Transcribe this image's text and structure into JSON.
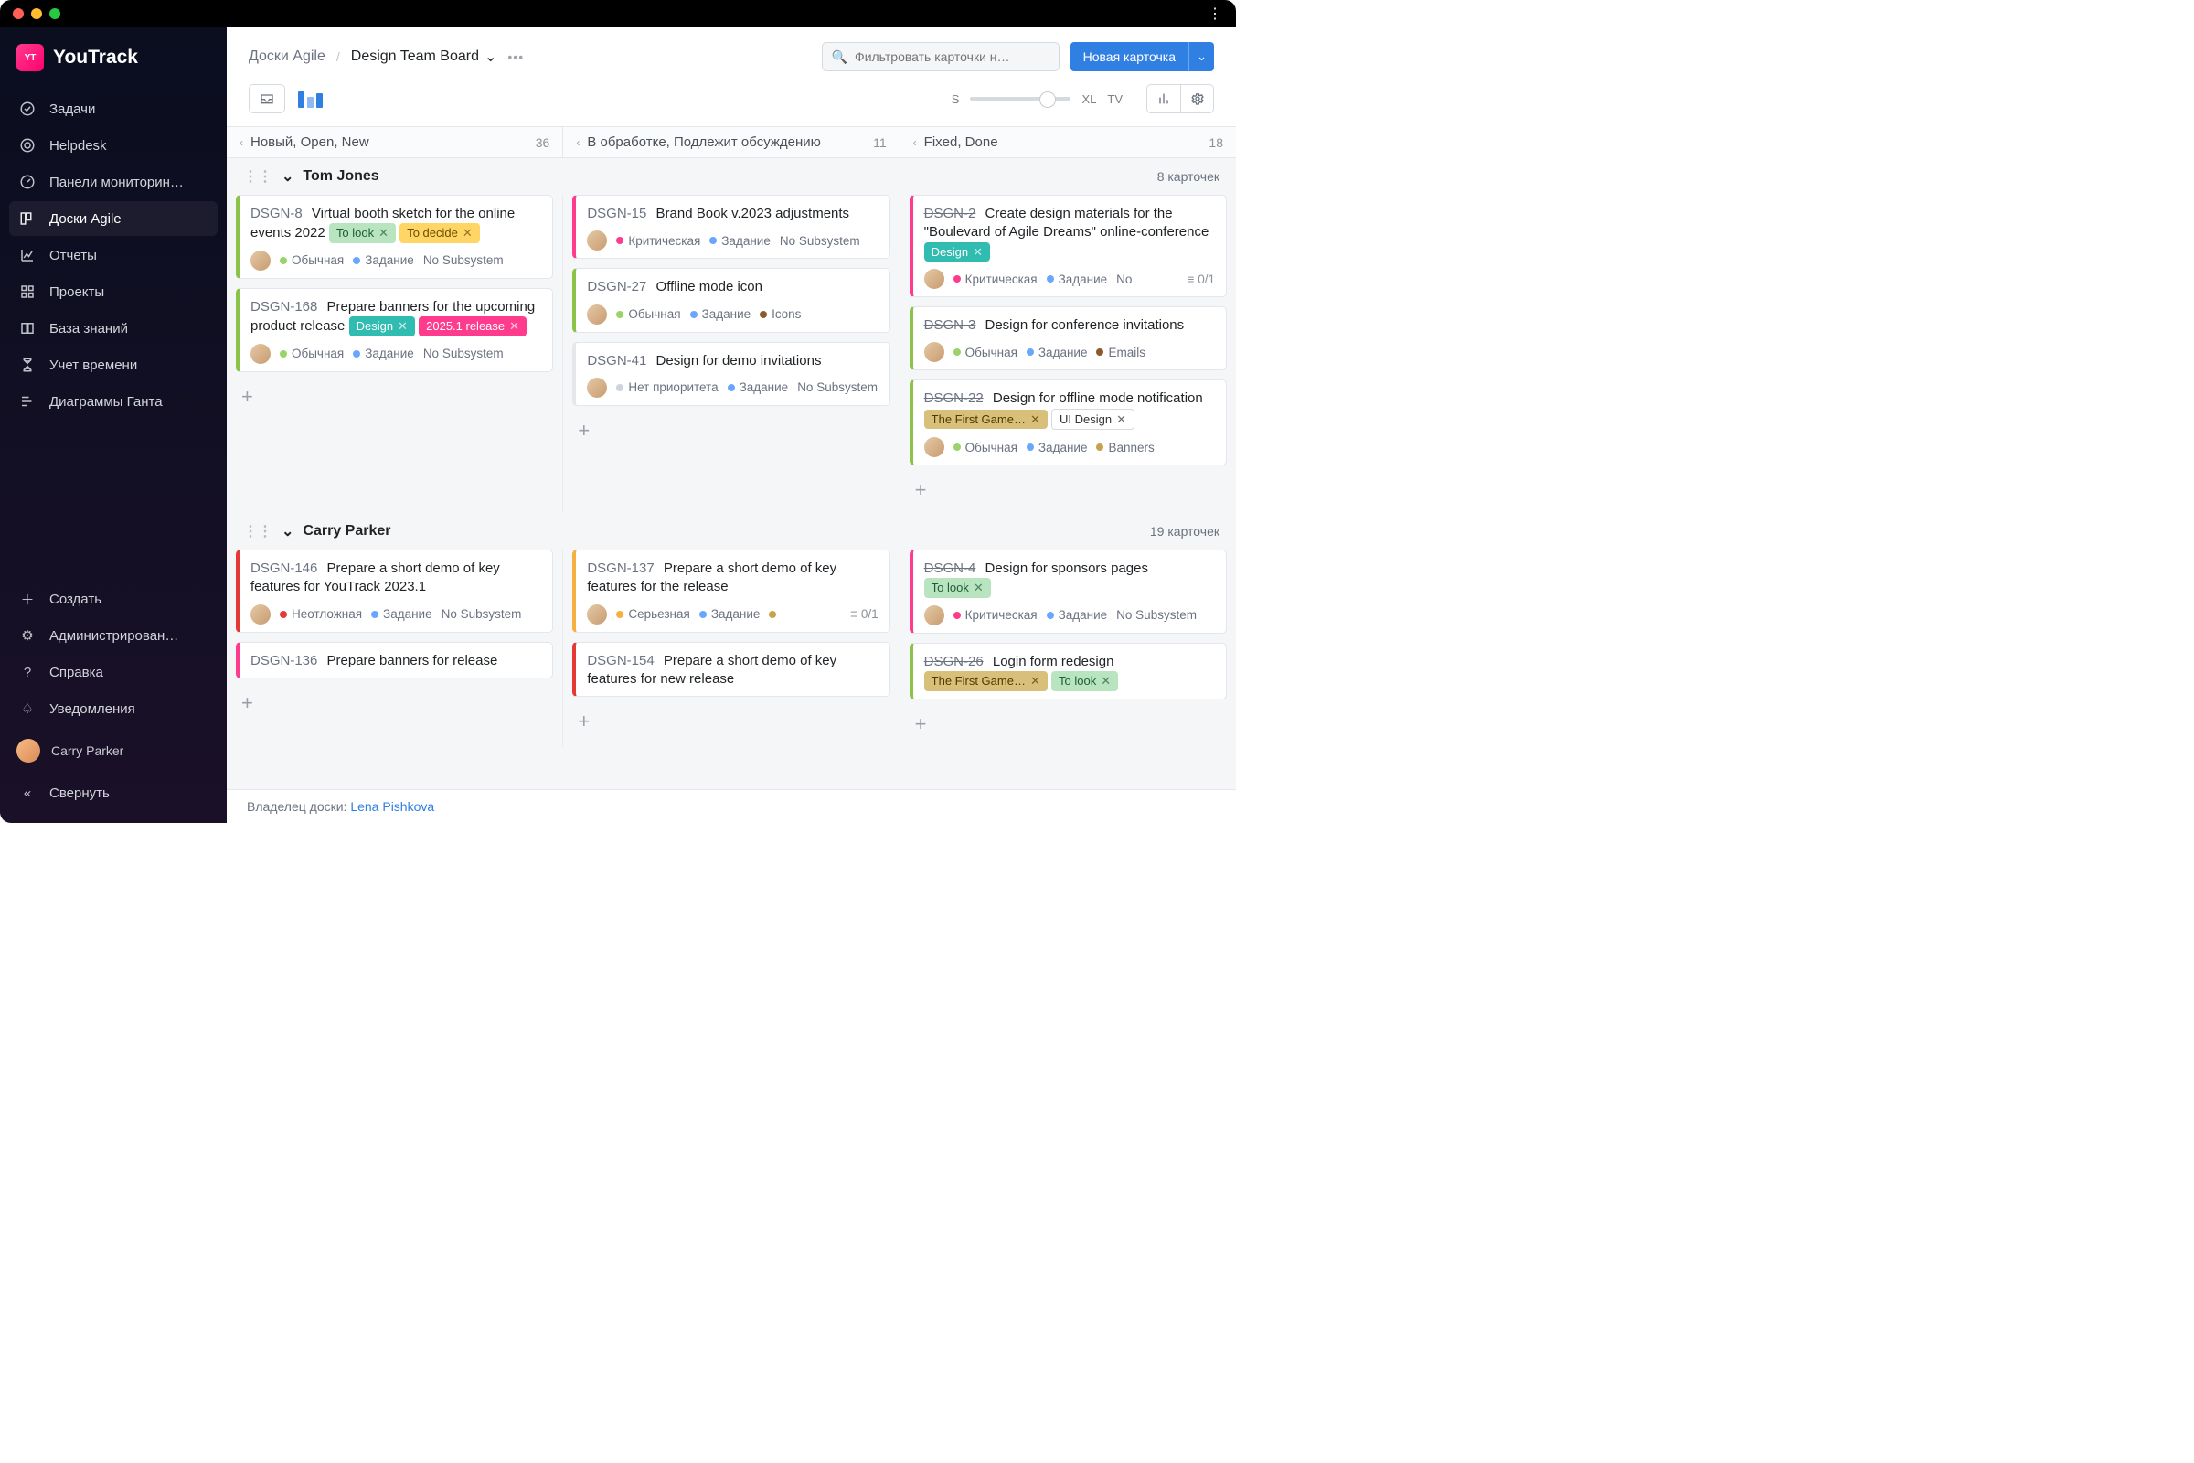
{
  "app": {
    "name": "YouTrack"
  },
  "sidebar": {
    "items": [
      {
        "label": "Задачи",
        "icon": "check-circle-icon"
      },
      {
        "label": "Helpdesk",
        "icon": "life-ring-icon"
      },
      {
        "label": "Панели мониторин…",
        "icon": "gauge-icon"
      },
      {
        "label": "Доски Agile",
        "icon": "board-icon",
        "active": true
      },
      {
        "label": "Отчеты",
        "icon": "chart-icon"
      },
      {
        "label": "Проекты",
        "icon": "grid-icon"
      },
      {
        "label": "База знаний",
        "icon": "book-icon"
      },
      {
        "label": "Учет времени",
        "icon": "hourglass-icon"
      },
      {
        "label": "Диаграммы Ганта",
        "icon": "gantt-icon"
      }
    ],
    "create": "Создать",
    "admin": "Администрирован…",
    "help": "Справка",
    "notifications": "Уведомления",
    "user": "Carry Parker",
    "collapse": "Свернуть"
  },
  "header": {
    "breadcrumb_root": "Доски Agile",
    "board_name": "Design Team Board",
    "search_placeholder": "Фильтровать карточки н…",
    "new_card": "Новая карточка",
    "size_s": "S",
    "size_xl": "XL",
    "size_tv": "TV"
  },
  "columns": [
    {
      "title": "Новый, Open, New",
      "count": "36"
    },
    {
      "title": "В обработке, Подлежит обсуждению",
      "count": "11"
    },
    {
      "title": "Fixed, Done",
      "count": "18"
    }
  ],
  "swimlanes": [
    {
      "name": "Tom Jones",
      "count": "8 карточек",
      "cols": [
        [
          {
            "id": "DSGN-8",
            "title": "Virtual booth sketch for the online events 2022",
            "stripe": "#8bc34a",
            "tags": [
              {
                "text": "To look",
                "bg": "#b8e4c0",
                "fg": "#1f5d2f",
                "x": true
              },
              {
                "text": "To decide",
                "bg": "#ffd666",
                "fg": "#6b4e00",
                "x": true
              }
            ],
            "meta": {
              "priority": {
                "text": "Обычная",
                "color": "#9ad36a"
              },
              "type": {
                "text": "Задание",
                "color": "#6aa6ff"
              },
              "subsystem": "No Subsystem"
            }
          },
          {
            "id": "DSGN-168",
            "title": "Prepare banners for the upcoming product release",
            "stripe": "#8bc34a",
            "tags": [
              {
                "text": "Design",
                "bg": "#30bcb0",
                "fg": "#ffffff",
                "x": true
              },
              {
                "text": "2025.1 release",
                "bg": "#ff3b8d",
                "fg": "#ffffff",
                "x": true
              }
            ],
            "meta": {
              "priority": {
                "text": "Обычная",
                "color": "#9ad36a"
              },
              "type": {
                "text": "Задание",
                "color": "#6aa6ff"
              },
              "subsystem": "No Subsystem"
            }
          }
        ],
        [
          {
            "id": "DSGN-15",
            "title": "Brand Book v.2023 adjustments",
            "stripe": "#ff3b8d",
            "meta": {
              "priority": {
                "text": "Критическая",
                "color": "#ff3b8d"
              },
              "type": {
                "text": "Задание",
                "color": "#6aa6ff"
              },
              "subsystem": "No Subsystem"
            }
          },
          {
            "id": "DSGN-27",
            "title": "Offline mode icon",
            "stripe": "#8bc34a",
            "meta": {
              "priority": {
                "text": "Обычная",
                "color": "#9ad36a"
              },
              "type": {
                "text": "Задание",
                "color": "#6aa6ff"
              },
              "subsystem": "Icons",
              "sub_color": "#8b5a2b"
            }
          },
          {
            "id": "DSGN-41",
            "title": "Design for demo invitations",
            "stripe": "#e5e7eb",
            "meta": {
              "priority": {
                "text": "Нет приоритета",
                "color": "#cfd3da"
              },
              "type": {
                "text": "Задание",
                "color": "#6aa6ff"
              },
              "subsystem": "No Subsystem"
            }
          }
        ],
        [
          {
            "id": "DSGN-2",
            "done": true,
            "title": "Create design materials for the \"Boulevard of Agile Dreams\" online-conference",
            "stripe": "#ff3b8d",
            "tags": [
              {
                "text": "Design",
                "bg": "#30bcb0",
                "fg": "#ffffff",
                "x": true
              }
            ],
            "meta": {
              "priority": {
                "text": "Критическая",
                "color": "#ff3b8d"
              },
              "type": {
                "text": "Задание",
                "color": "#6aa6ff"
              },
              "subsystem": "No",
              "subcount": "0/1"
            }
          },
          {
            "id": "DSGN-3",
            "done": true,
            "title": "Design for conference invitations",
            "stripe": "#8bc34a",
            "meta": {
              "priority": {
                "text": "Обычная",
                "color": "#9ad36a"
              },
              "type": {
                "text": "Задание",
                "color": "#6aa6ff"
              },
              "subsystem": "Emails",
              "sub_color": "#8b5a2b"
            }
          },
          {
            "id": "DSGN-22",
            "done": true,
            "title": "Design for offline mode notification",
            "stripe": "#8bc34a",
            "tags": [
              {
                "text": "The First Game…",
                "bg": "#d9c07a",
                "fg": "#4d3b00",
                "x": true
              },
              {
                "text": "UI Design",
                "bg": "#ffffff",
                "fg": "#333333",
                "x": true,
                "border": "#d5d9e0"
              }
            ],
            "meta": {
              "priority": {
                "text": "Обычная",
                "color": "#9ad36a"
              },
              "type": {
                "text": "Задание",
                "color": "#6aa6ff"
              },
              "subsystem": "Banners",
              "sub_color": "#c7a24a"
            }
          }
        ]
      ]
    },
    {
      "name": "Carry Parker",
      "count": "19 карточек",
      "cols": [
        [
          {
            "id": "DSGN-146",
            "title": "Prepare a short demo of key features for YouTrack 2023.1",
            "stripe": "#e53935",
            "meta": {
              "priority": {
                "text": "Неотложная",
                "color": "#e53935"
              },
              "type": {
                "text": "Задание",
                "color": "#6aa6ff"
              },
              "subsystem": "No Subsystem"
            }
          },
          {
            "id": "DSGN-136",
            "title": "Prepare banners for release",
            "stripe": "#ff3b8d"
          }
        ],
        [
          {
            "id": "DSGN-137",
            "title": "Prepare a short demo of key features for the release",
            "stripe": "#f5b041",
            "meta": {
              "priority": {
                "text": "Серьезная",
                "color": "#f5b041"
              },
              "type": {
                "text": "Задание",
                "color": "#6aa6ff"
              },
              "subsystem": "",
              "sub_color": "#c7a24a",
              "subcount": "0/1"
            }
          },
          {
            "id": "DSGN-154",
            "title": "Prepare a short demo of key features for new release",
            "stripe": "#e53935"
          }
        ],
        [
          {
            "id": "DSGN-4",
            "done": true,
            "title": "Design for sponsors pages",
            "stripe": "#ff3b8d",
            "tags": [
              {
                "text": "To look",
                "bg": "#b8e4c0",
                "fg": "#1f5d2f",
                "x": true
              }
            ],
            "meta": {
              "priority": {
                "text": "Критическая",
                "color": "#ff3b8d"
              },
              "type": {
                "text": "Задание",
                "color": "#6aa6ff"
              },
              "subsystem": "No Subsystem"
            }
          },
          {
            "id": "DSGN-26",
            "done": true,
            "title": "Login form redesign",
            "stripe": "#8bc34a",
            "tags": [
              {
                "text": "The First Game…",
                "bg": "#d9c07a",
                "fg": "#4d3b00",
                "x": true
              },
              {
                "text": "To look",
                "bg": "#b8e4c0",
                "fg": "#1f5d2f",
                "x": true
              }
            ]
          }
        ]
      ]
    }
  ],
  "footer": {
    "prefix": "Владелец доски: ",
    "owner": "Lena Pishkova"
  },
  "icons": {
    "check-circle-icon": "◯✓",
    "life-ring-icon": "◎",
    "gauge-icon": "◷",
    "board-icon": "▥",
    "chart-icon": "⬀",
    "grid-icon": "▦",
    "book-icon": "▭",
    "hourglass-icon": "⧗",
    "gantt-icon": "≣",
    "plus-icon": "＋",
    "gear-icon": "⚙",
    "help-icon": "?",
    "bell-icon": "🔔",
    "collapse-icon": "«",
    "search-icon": "🔍",
    "chevron-down-icon": "⌄",
    "bars-icon": "⫼"
  }
}
